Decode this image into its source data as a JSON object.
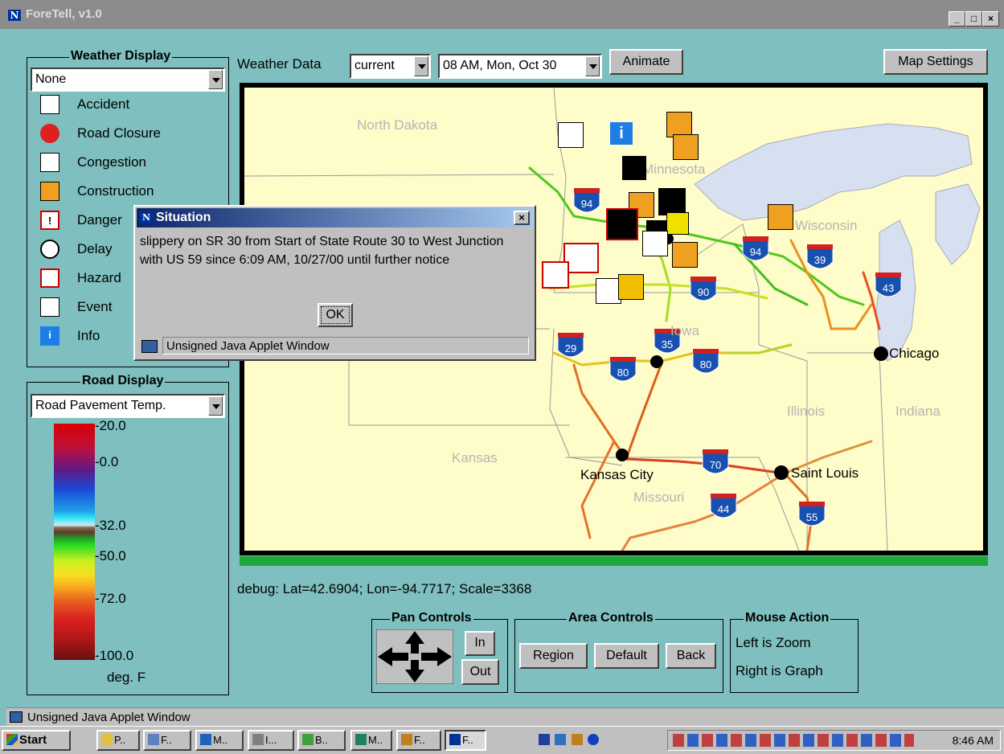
{
  "window": {
    "title": "ForeTell, v1.0",
    "min_glyph": "_",
    "max_glyph": "□",
    "close_glyph": "×"
  },
  "weather_display": {
    "group_label": "Weather Display",
    "select_value": "None",
    "legend": [
      {
        "label": "Accident",
        "icon": "accident-icon"
      },
      {
        "label": "Road Closure",
        "icon": "road-closure-icon"
      },
      {
        "label": "Congestion",
        "icon": "congestion-icon"
      },
      {
        "label": "Construction",
        "icon": "construction-icon"
      },
      {
        "label": "Danger",
        "icon": "danger-icon",
        "glyph": "!"
      },
      {
        "label": "Delay",
        "icon": "delay-icon"
      },
      {
        "label": "Hazard",
        "icon": "hazard-icon"
      },
      {
        "label": "Event",
        "icon": "event-icon"
      },
      {
        "label": "Info",
        "icon": "info-icon",
        "glyph": "i"
      }
    ]
  },
  "road_display": {
    "group_label": "Road Display",
    "select_value": "Road Pavement Temp.",
    "scale_labels": [
      "-20.0",
      "-0.0",
      "-32.0",
      "-50.0",
      "-72.0",
      "-100.0"
    ],
    "units": "deg. F"
  },
  "toolbar": {
    "weather_data_label": "Weather Data",
    "data_select": "current",
    "time_select": "08 AM, Mon, Oct 30",
    "animate_label": "Animate",
    "map_settings_label": "Map Settings"
  },
  "map": {
    "states": [
      "North Dakota",
      "Minnesota",
      "Wisconsin",
      "Iowa",
      "Illinois",
      "Indiana",
      "Kansas",
      "Missouri"
    ],
    "cities": [
      "Chicago",
      "Kansas City",
      "Saint Louis"
    ],
    "interstates": [
      "94",
      "94",
      "39",
      "43",
      "90",
      "35",
      "29",
      "80",
      "80",
      "70",
      "44",
      "55"
    ],
    "colors": {
      "background": "#fefcc8",
      "lake": "#d6e0f0",
      "border": "#000000",
      "footer_bar": "#1fa83a"
    }
  },
  "debug_text": "debug: Lat=42.6904; Lon=-94.7717; Scale=3368",
  "pan_controls": {
    "label": "Pan Controls",
    "in": "In",
    "out": "Out"
  },
  "area_controls": {
    "label": "Area Controls",
    "region": "Region",
    "default": "Default",
    "back": "Back"
  },
  "mouse_action": {
    "label": "Mouse Action",
    "left": "Left is Zoom",
    "right": "Right is Graph"
  },
  "status_bar": {
    "text": "Unsigned Java Applet Window"
  },
  "dialog": {
    "title": "Situation",
    "close_glyph": "×",
    "message": "slippery on SR 30 from Start of State Route 30 to West Junction with US 59 since 6:09 AM, 10/27/00 until further notice",
    "ok_label": "OK",
    "status": "Unsigned Java Applet Window"
  },
  "taskbar": {
    "start_label": "Start",
    "tasks": [
      "P..",
      "F..",
      "M..",
      "I...",
      "B..",
      "M..",
      "F..",
      "F.."
    ],
    "clock": "8:46 AM"
  }
}
